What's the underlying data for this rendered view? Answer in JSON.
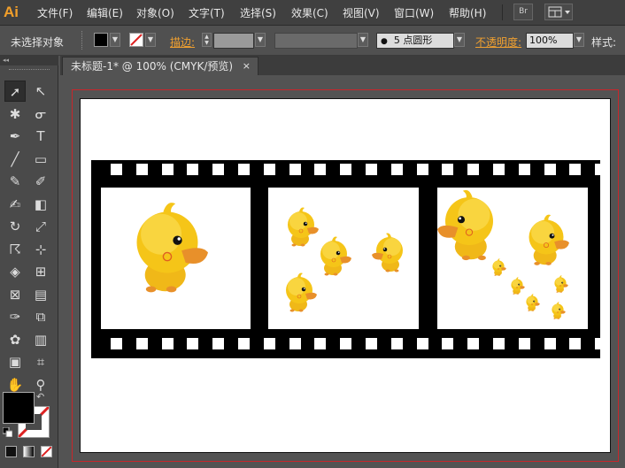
{
  "app": {
    "logo": "Ai"
  },
  "menu": [
    "文件(F)",
    "编辑(E)",
    "对象(O)",
    "文字(T)",
    "选择(S)",
    "效果(C)",
    "视图(V)",
    "窗口(W)",
    "帮助(H)"
  ],
  "bridge_button": "Br",
  "control_bar": {
    "selection_status": "未选择对象",
    "stroke_label": "描边:",
    "brush_label": "5 点圆形",
    "opacity_label": "不透明度:",
    "opacity_value": "100%",
    "style_label": "样式:"
  },
  "document_tab": {
    "title": "未标题-1* @ 100% (CMYK/预览)",
    "close": "×"
  },
  "colors": {
    "accent": "#f0a030",
    "bleed": "#c8262b",
    "film": "#000000",
    "duck": "#f5c518",
    "beak": "#e8902a"
  },
  "icons": [
    "selection-icon",
    "direct-selection-icon",
    "magic-wand-icon",
    "lasso-icon",
    "pen-icon",
    "type-icon",
    "line-icon",
    "rectangle-icon",
    "paintbrush-icon",
    "pencil-icon",
    "blob-brush-icon",
    "eraser-icon",
    "rotate-icon",
    "scale-icon",
    "warp-icon",
    "free-transform-icon",
    "shape-builder-icon",
    "perspective-grid-icon",
    "mesh-icon",
    "gradient-icon",
    "eyedropper-icon",
    "blend-icon",
    "symbol-sprayer-icon",
    "column-graph-icon",
    "artboard-icon",
    "slice-icon",
    "hand-icon",
    "zoom-icon"
  ]
}
